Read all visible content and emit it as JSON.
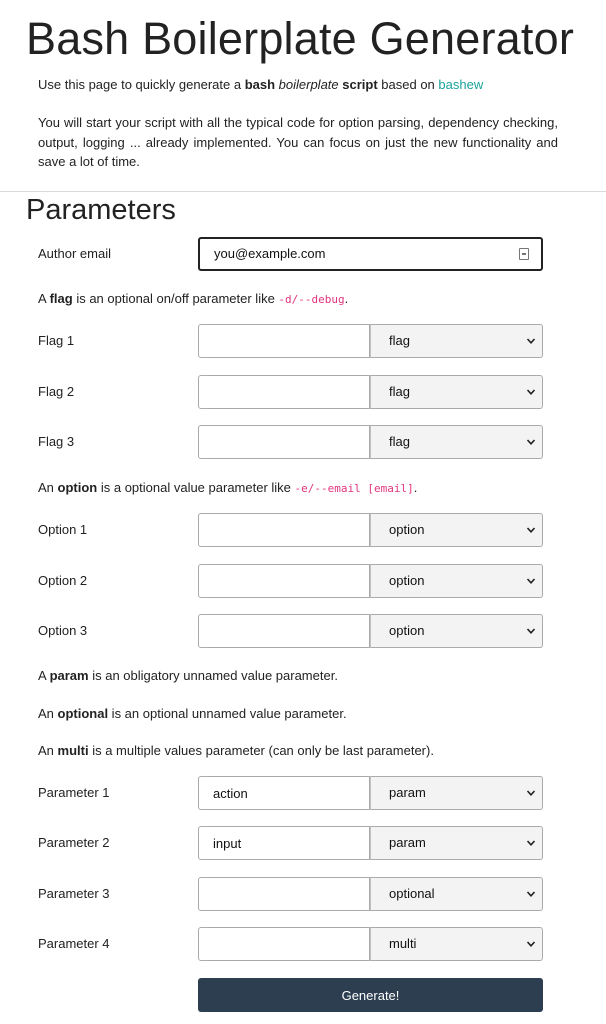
{
  "title": "Bash Boilerplate Generator",
  "intro": {
    "t1": "Use this page to quickly generate a ",
    "bash": "bash",
    "boilerplate": "boilerplate",
    "script": "script",
    "t2": " based on ",
    "link": "bashew"
  },
  "description": "You will start your script with all the typical code for option parsing, dependency checking, output, logging ... already implemented. You can focus on just the new functionality and save a lot of time.",
  "section_title": "Parameters",
  "author": {
    "label": "Author email",
    "value": "you@example.com"
  },
  "flag_note": {
    "t1": "A ",
    "term": "flag",
    "t2": " is an optional on/off parameter like ",
    "code": "-d/--debug",
    "t3": "."
  },
  "option_note": {
    "t1": "An ",
    "term": "option",
    "t2": " is a optional value parameter like ",
    "code": "-e/--email [email]",
    "t3": "."
  },
  "param_note": {
    "t1": "A ",
    "term": "param",
    "t2": " is an obligatory unnamed value parameter."
  },
  "optional_note": {
    "t1": "An ",
    "term": "optional",
    "t2": " is an optional unnamed value parameter."
  },
  "multi_note": {
    "t1": "An ",
    "term": "multi",
    "t2": " is a multiple values parameter (can only be last parameter)."
  },
  "rows": [
    {
      "label": "Flag 1",
      "value": "",
      "type": "flag"
    },
    {
      "label": "Flag 2",
      "value": "",
      "type": "flag"
    },
    {
      "label": "Flag 3",
      "value": "",
      "type": "flag"
    },
    {
      "label": "Option 1",
      "value": "",
      "type": "option"
    },
    {
      "label": "Option 2",
      "value": "",
      "type": "option"
    },
    {
      "label": "Option 3",
      "value": "",
      "type": "option"
    },
    {
      "label": "Parameter 1",
      "value": "action",
      "type": "param"
    },
    {
      "label": "Parameter 2",
      "value": "input",
      "type": "param"
    },
    {
      "label": "Parameter 3",
      "value": "",
      "type": "optional"
    },
    {
      "label": "Parameter 4",
      "value": "",
      "type": "multi"
    }
  ],
  "generate_label": "Generate!",
  "colors": {
    "link": "#1aa39a",
    "code": "#e0357f",
    "button": "#2c3e50"
  }
}
